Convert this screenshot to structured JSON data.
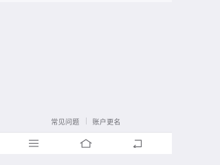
{
  "footer": {
    "faq_label": "常见问题",
    "rename_account_label": "账户更名"
  },
  "nav_bar": {
    "menu_icon": "menu-icon",
    "home_icon": "home-icon",
    "back_icon": "back-icon"
  }
}
